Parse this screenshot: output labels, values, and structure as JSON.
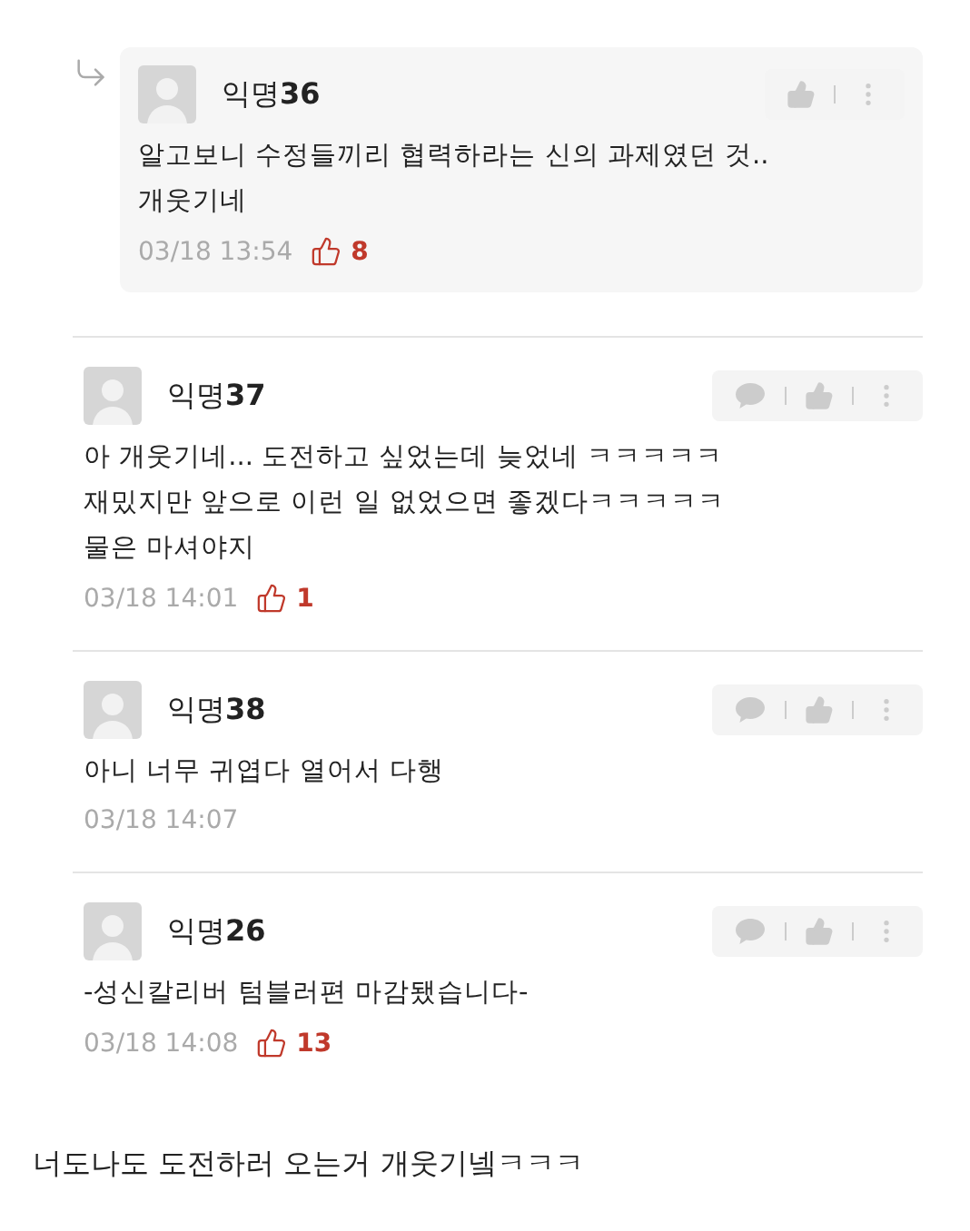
{
  "comments": [
    {
      "kind": "reply",
      "author": "익명**36**",
      "text": "알고보니 수정들끼리 협력하라는 신의 과제였던 것..\n개웃기네",
      "time": "03/18 13:54",
      "likes": "8",
      "comment_action": false
    },
    {
      "kind": "comment",
      "author": "익명**37**",
      "text": "아 개웃기네... 도전하고 싶었는데 늦었네 ㅋㅋㅋㅋㅋ\n재밌지만 앞으로 이런 일 없었으면 좋겠다ㅋㅋㅋㅋㅋ\n물은 마셔야지",
      "time": "03/18 14:01",
      "likes": "1",
      "comment_action": true
    },
    {
      "kind": "comment",
      "author": "익명**38**",
      "text": "아니 너무 귀엽다 열어서 다행",
      "time": "03/18 14:07",
      "comment_action": true
    },
    {
      "kind": "comment",
      "author": "익명**26**",
      "text": "-성신칼리버 텀블러편 마감됐습니다-",
      "time": "03/18 14:08",
      "likes": "13",
      "comment_action": true
    }
  ],
  "caption": "너도나도 도전하러 오는거 개웃기넼ㅋㅋㅋ"
}
